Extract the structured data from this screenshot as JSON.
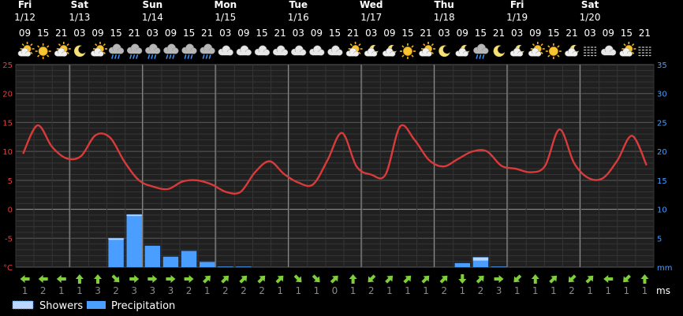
{
  "chart_data": {
    "type": "line",
    "days": [
      {
        "name": "Fri",
        "date": "1/12"
      },
      {
        "name": "Sat",
        "date": "1/13"
      },
      {
        "name": "Sun",
        "date": "1/14"
      },
      {
        "name": "Mon",
        "date": "1/15"
      },
      {
        "name": "Tue",
        "date": "1/16"
      },
      {
        "name": "Wed",
        "date": "1/17"
      },
      {
        "name": "Thu",
        "date": "1/18"
      },
      {
        "name": "Fri",
        "date": "1/19"
      },
      {
        "name": "Sat",
        "date": "1/20"
      }
    ],
    "hours": [
      "09",
      "15",
      "21",
      "03",
      "09",
      "15",
      "21",
      "03",
      "09",
      "15",
      "21",
      "03",
      "09",
      "15",
      "21",
      "03",
      "09",
      "15",
      "21",
      "03",
      "09",
      "15",
      "21",
      "03",
      "09",
      "15",
      "21",
      "03",
      "09",
      "15",
      "21",
      "03",
      "09",
      "15",
      "21"
    ],
    "weather_icons": [
      "sun-cloud",
      "sun",
      "sun-cloud",
      "moon",
      "sun-cloud",
      "rain",
      "rain",
      "rain",
      "rain",
      "rain",
      "rain",
      "cloud",
      "cloud",
      "cloud",
      "cloud",
      "cloud",
      "cloud",
      "cloud",
      "sun-cloud",
      "moon-cloud",
      "moon-cloud",
      "sun",
      "sun-cloud",
      "moon",
      "moon-cloud",
      "rain",
      "moon",
      "moon-cloud",
      "sun-cloud",
      "sun",
      "moon-cloud",
      "fog",
      "cloud",
      "sun-cloud",
      "fog"
    ],
    "temperature_c": [
      9.6,
      14.5,
      10.8,
      8.8,
      9.2,
      12.8,
      12.4,
      8.2,
      5.0,
      3.9,
      3.5,
      4.8,
      5.0,
      4.3,
      3.0,
      3.0,
      6.4,
      8.3,
      6.1,
      4.6,
      4.3,
      8.5,
      13.2,
      7.4,
      6.0,
      6.0,
      14.3,
      12.0,
      8.5,
      7.4,
      8.7,
      10.0,
      10.0,
      7.5,
      7.0,
      6.4,
      7.5,
      13.8,
      8.0,
      5.4,
      5.4,
      8.5,
      12.7,
      7.6
    ],
    "precipitation_mm": [
      0,
      0,
      0,
      0,
      0,
      4.7,
      8.8,
      3.7,
      1.8,
      2.8,
      0.9,
      0.1,
      0.1,
      0,
      0,
      0,
      0,
      0,
      0,
      0,
      0,
      0,
      0,
      0,
      0.7,
      1.1,
      0.1,
      0,
      0,
      0,
      0,
      0,
      0,
      0,
      0
    ],
    "showers_mm": [
      0,
      0,
      0,
      0,
      0,
      0.3,
      0.3,
      0,
      0,
      0,
      0,
      0,
      0,
      0,
      0,
      0,
      0,
      0,
      0,
      0,
      0,
      0,
      0,
      0,
      0,
      0.6,
      0,
      0,
      0,
      0,
      0,
      0,
      0,
      0,
      0
    ],
    "wind_dir": [
      "W",
      "W",
      "W",
      "N",
      "N",
      "SE",
      "E",
      "E",
      "E",
      "E",
      "NE",
      "NE",
      "NE",
      "NE",
      "NE",
      "SE",
      "SE",
      "NE",
      "N",
      "SW",
      "NE",
      "NE",
      "NE",
      "NE",
      "S",
      "NE",
      "E",
      "SW",
      "N",
      "NE",
      "SW",
      "NE",
      "W",
      "SW",
      "N"
    ],
    "wind_speed": [
      "1",
      "2",
      "1",
      "1",
      "3",
      "2",
      "3",
      "3",
      "3",
      "2",
      "1",
      "2",
      "2",
      "2",
      "1",
      "1",
      "1",
      "0",
      "1",
      "2",
      "1",
      "1",
      "1",
      "2",
      "1",
      "2",
      "3",
      "1",
      "1",
      "1",
      "2",
      "1",
      "1",
      "1",
      "1"
    ],
    "wind_unit": "ms",
    "y_left": {
      "unit": "°C",
      "ticks": [
        "25",
        "20",
        "15",
        "10",
        "5",
        "0",
        "-5"
      ],
      "ylim": [
        -10,
        25
      ]
    },
    "y_right": {
      "unit": "mm",
      "ticks": [
        "35",
        "30",
        "25",
        "20",
        "15",
        "10",
        "5"
      ],
      "ylim": [
        0,
        35
      ]
    },
    "legend": [
      {
        "name": "Showers",
        "color": "#4a9eff"
      },
      {
        "name": "Precipitation",
        "color": "#4a9eff"
      }
    ],
    "colors": {
      "temperature": "#d93a3a",
      "precipitation": "#4a9eff",
      "grid": "#3a3a3a",
      "background": "#000000",
      "plot_bg": "#202020",
      "wind_arrow": "#7ecf3a"
    }
  }
}
